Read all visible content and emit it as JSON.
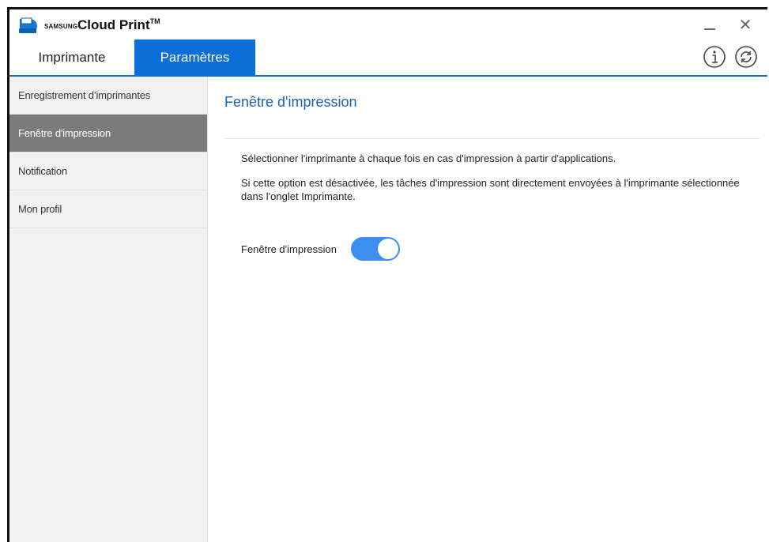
{
  "app": {
    "brand_small": "SAMSUNG",
    "brand_name": "Cloud Print",
    "brand_tm": "TM",
    "accent_color": "#0a6fd8",
    "logo_icon": "cloud-printer-icon"
  },
  "window_controls": {
    "minimize_icon": "minimize-icon",
    "close_symbol": "✕"
  },
  "tabs": [
    {
      "label": "Imprimante",
      "active": false
    },
    {
      "label": "Paramètres",
      "active": true
    }
  ],
  "toolbar": {
    "info_icon": "info-icon",
    "refresh_icon": "refresh-icon"
  },
  "sidebar": {
    "items": [
      {
        "label": "Enregistrement d’imprimantes",
        "active": false
      },
      {
        "label": "Fenêtre d'impression",
        "active": true
      },
      {
        "label": "Notification",
        "active": false
      },
      {
        "label": "Mon profil",
        "active": false
      }
    ]
  },
  "content": {
    "title": "Fenêtre d'impression",
    "description_1": "Sélectionner l'imprimante à chaque fois en cas d'impression à partir d'applications.",
    "description_2": "Si cette option est désactivée, les tâches d'impression sont directement envoyées à l'imprimante sélectionnée dans l'onglet Imprimante.",
    "toggle_label": "Fenêtre d'impression",
    "toggle_on": true,
    "toggle_color": "#3d8ef0"
  }
}
